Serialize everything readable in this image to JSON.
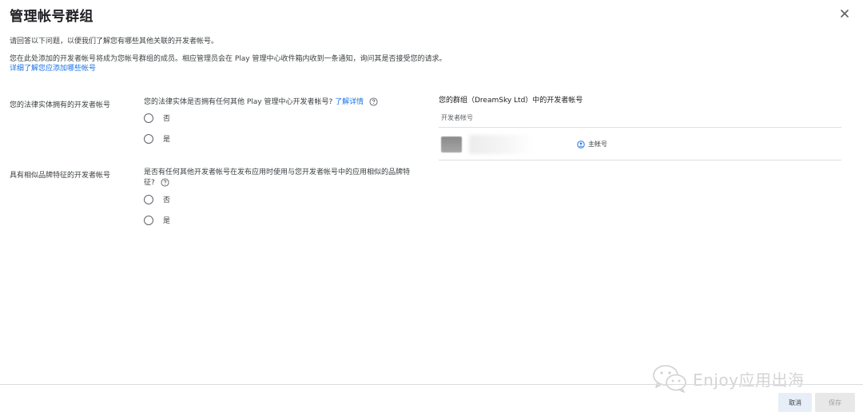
{
  "dialog": {
    "title": "管理帐号群组"
  },
  "intro": {
    "line1": "请回答以下问题，以便我们了解您有哪些其他关联的开发者帐号。",
    "line2": "您在此处添加的开发者帐号将成为您帐号群组的成员。相应管理员会在 Play 管理中心收件箱内收到一条通知，询问其是否接受您的请求。",
    "learn_link": "详细了解您应添加哪些帐号"
  },
  "section1": {
    "label": "您的法律实体拥有的开发者帐号",
    "question": "您的法律实体是否拥有任何其他 Play 管理中心开发者帐号?",
    "learn_more": "了解详情",
    "options": [
      "否",
      "是"
    ]
  },
  "section2": {
    "label": "具有相似品牌特征的开发者帐号",
    "question_line1": "是否有任何其他开发者帐号在发布应用时使用与您开发者帐号中的应用相似的品牌特",
    "question_line2": "征?",
    "options": [
      "否",
      "是"
    ]
  },
  "group": {
    "title": "您的群组（DreamSky Ltd）中的开发者帐号",
    "column_header": "开发者帐号",
    "row": {
      "badge": "主帐号"
    }
  },
  "footer": {
    "cancel": "取消",
    "save": "保存"
  },
  "watermark": {
    "text": "Enjoy应用出海"
  },
  "icons": {
    "close": "close-icon",
    "help": "help-circle-icon",
    "primary": "primary-account-icon",
    "wechat": "wechat-icon"
  }
}
